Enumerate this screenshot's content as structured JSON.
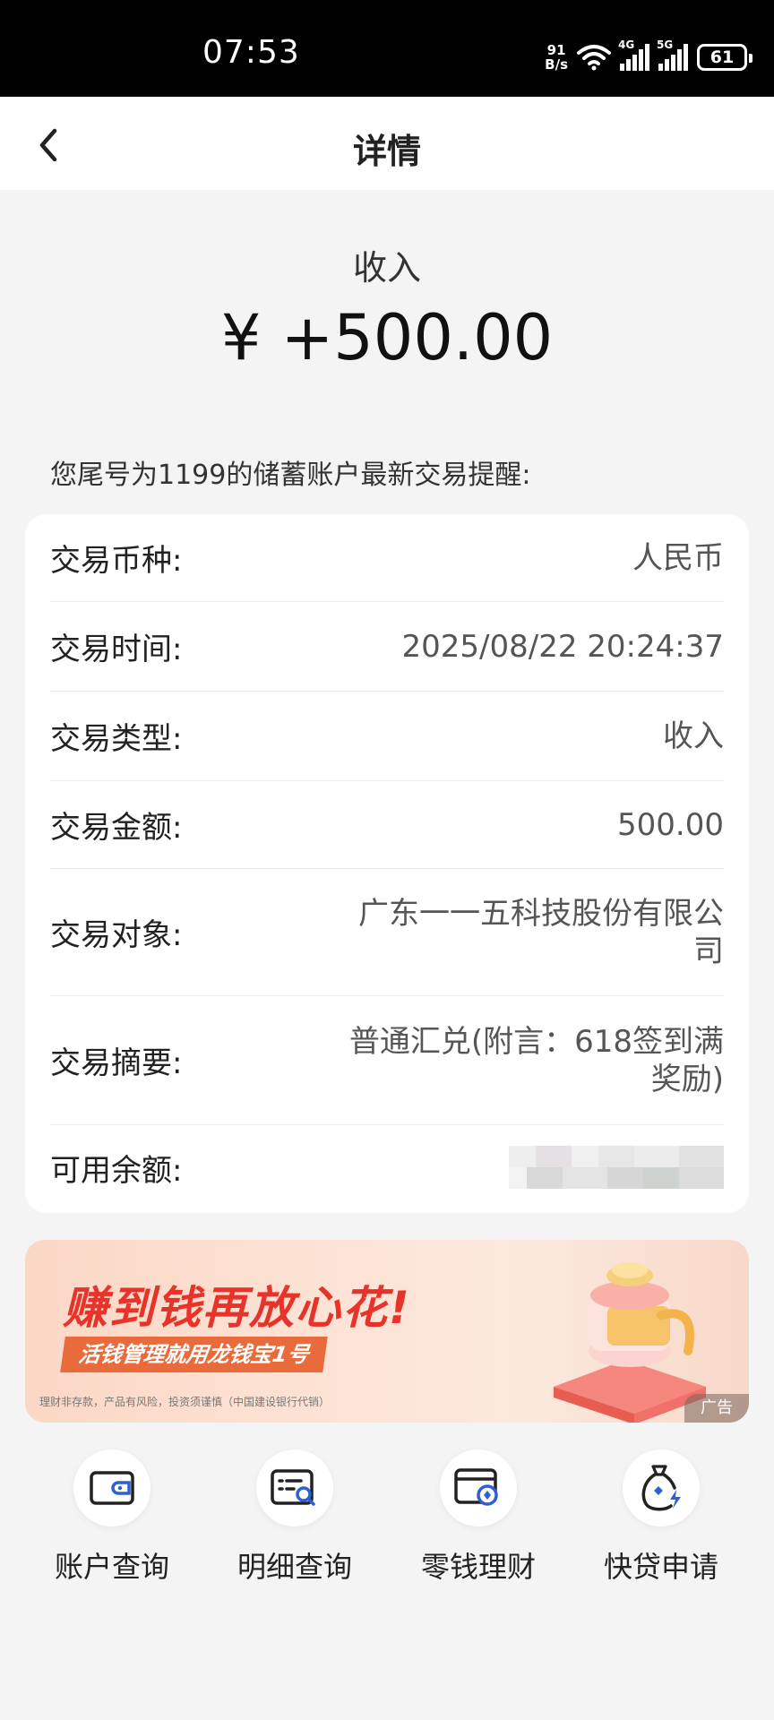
{
  "status_bar": {
    "time": "07:53",
    "net_speed_top": "91",
    "net_speed_bottom": "B/s",
    "sig1": "4G",
    "sig2": "5G",
    "battery": "61"
  },
  "nav": {
    "title": "详情"
  },
  "summary": {
    "label": "收入",
    "amount": "¥ +500.00"
  },
  "notice": "您尾号为1199的储蓄账户最新交易提醒:",
  "details": [
    {
      "key": "交易币种:",
      "value": "人民币"
    },
    {
      "key": "交易时间:",
      "value": "2025/08/22 20:24:37"
    },
    {
      "key": "交易类型:",
      "value": "收入"
    },
    {
      "key": "交易金额:",
      "value": "500.00"
    },
    {
      "key": "交易对象:",
      "value": "广东一一五科技股份有限公司"
    },
    {
      "key": "交易摘要:",
      "value": "普通汇兑(附言：618签到满奖励)"
    },
    {
      "key": "可用余额:",
      "value": ""
    }
  ],
  "banner": {
    "title": "赚到钱再放心花!",
    "subtitle": "活钱管理就用龙钱宝1号",
    "fine_print": "理财非存款，产品有风险，投资须谨慎（中国建设银行代销）",
    "ad_tag": "广告"
  },
  "shortcuts": [
    {
      "label": "账户查询",
      "icon": "wallet-icon"
    },
    {
      "label": "明细查询",
      "icon": "statement-search-icon"
    },
    {
      "label": "零钱理财",
      "icon": "card-coin-icon"
    },
    {
      "label": "快贷申请",
      "icon": "money-bag-lightning-icon"
    }
  ],
  "colors": {
    "brand_red": "#e8332b",
    "accent_blue": "#2f5fd0",
    "background": "#f4f4f4"
  }
}
